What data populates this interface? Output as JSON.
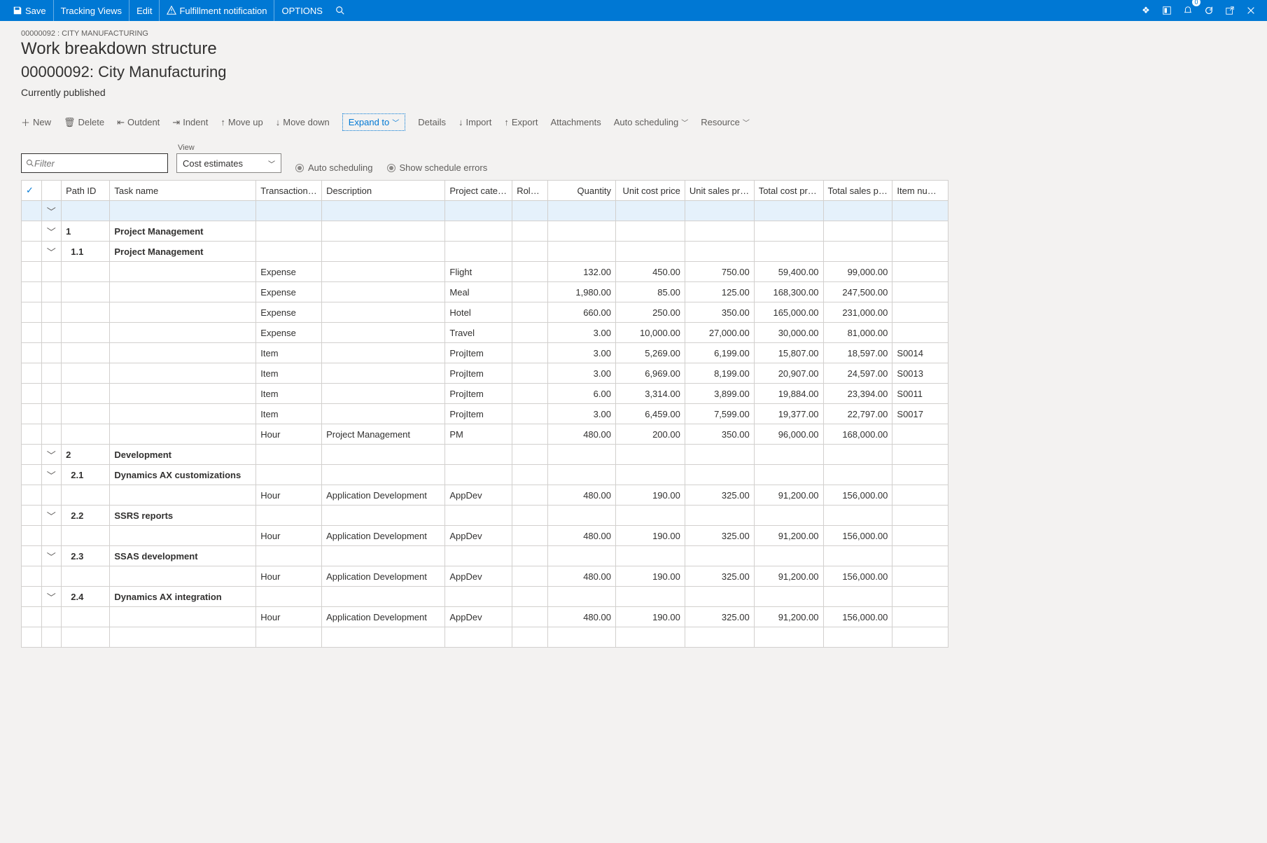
{
  "topmenu": {
    "save": "Save",
    "tracking": "Tracking Views",
    "edit": "Edit",
    "fulfillment": "Fulfillment notification",
    "options": "OPTIONS",
    "badge_count": "0"
  },
  "page": {
    "breadcrumb": "00000092 : CITY MANUFACTURING",
    "title": "Work breakdown structure",
    "subtitle": "00000092: City Manufacturing",
    "status": "Currently published"
  },
  "toolbar": {
    "new": "New",
    "delete": "Delete",
    "outdent": "Outdent",
    "indent": "Indent",
    "moveup": "Move up",
    "movedown": "Move down",
    "expand": "Expand to",
    "details": "Details",
    "import": "Import",
    "export": "Export",
    "attachments": "Attachments",
    "autosched": "Auto scheduling",
    "resource": "Resource"
  },
  "filter": {
    "placeholder": "Filter",
    "view_label": "View",
    "view_value": "Cost estimates",
    "opt_autosched": "Auto scheduling",
    "opt_errors": "Show schedule errors"
  },
  "columns": {
    "pathid": "Path ID",
    "task": "Task name",
    "txtype": "Transaction type",
    "desc": "Description",
    "cat": "Project category",
    "role": "Role ID",
    "qty": "Quantity",
    "ucost": "Unit cost price",
    "usales": "Unit sales price",
    "tcost": "Total cost price",
    "tsales": "Total sales price",
    "item": "Item number"
  },
  "rows": [
    {
      "hl": true,
      "expand": true
    },
    {
      "expand": true,
      "pathid": "1",
      "task": "Project Management",
      "bold": true
    },
    {
      "expand": true,
      "pathid": "1.1",
      "task": "Project Management",
      "bold": true,
      "indent": 1
    },
    {
      "txtype": "Expense",
      "cat": "Flight",
      "qty": "132.00",
      "ucost": "450.00",
      "usales": "750.00",
      "tcost": "59,400.00",
      "tsales": "99,000.00"
    },
    {
      "txtype": "Expense",
      "cat": "Meal",
      "qty": "1,980.00",
      "ucost": "85.00",
      "usales": "125.00",
      "tcost": "168,300.00",
      "tsales": "247,500.00"
    },
    {
      "txtype": "Expense",
      "cat": "Hotel",
      "qty": "660.00",
      "ucost": "250.00",
      "usales": "350.00",
      "tcost": "165,000.00",
      "tsales": "231,000.00"
    },
    {
      "txtype": "Expense",
      "cat": "Travel",
      "qty": "3.00",
      "ucost": "10,000.00",
      "usales": "27,000.00",
      "tcost": "30,000.00",
      "tsales": "81,000.00"
    },
    {
      "txtype": "Item",
      "cat": "ProjItem",
      "qty": "3.00",
      "ucost": "5,269.00",
      "usales": "6,199.00",
      "tcost": "15,807.00",
      "tsales": "18,597.00",
      "item": "S0014"
    },
    {
      "txtype": "Item",
      "cat": "ProjItem",
      "qty": "3.00",
      "ucost": "6,969.00",
      "usales": "8,199.00",
      "tcost": "20,907.00",
      "tsales": "24,597.00",
      "item": "S0013"
    },
    {
      "txtype": "Item",
      "cat": "ProjItem",
      "qty": "6.00",
      "ucost": "3,314.00",
      "usales": "3,899.00",
      "tcost": "19,884.00",
      "tsales": "23,394.00",
      "item": "S0011"
    },
    {
      "txtype": "Item",
      "cat": "ProjItem",
      "qty": "3.00",
      "ucost": "6,459.00",
      "usales": "7,599.00",
      "tcost": "19,377.00",
      "tsales": "22,797.00",
      "item": "S0017"
    },
    {
      "txtype": "Hour",
      "desc": "Project Management",
      "cat": "PM",
      "qty": "480.00",
      "ucost": "200.00",
      "usales": "350.00",
      "tcost": "96,000.00",
      "tsales": "168,000.00"
    },
    {
      "expand": true,
      "pathid": "2",
      "task": "Development",
      "bold": true
    },
    {
      "expand": true,
      "pathid": "2.1",
      "task": "Dynamics AX customizations",
      "bold": true,
      "indent": 1
    },
    {
      "txtype": "Hour",
      "desc": "Application Development",
      "cat": "AppDev",
      "qty": "480.00",
      "ucost": "190.00",
      "usales": "325.00",
      "tcost": "91,200.00",
      "tsales": "156,000.00"
    },
    {
      "expand": true,
      "pathid": "2.2",
      "task": "SSRS reports",
      "bold": true,
      "indent": 1
    },
    {
      "txtype": "Hour",
      "desc": "Application Development",
      "cat": "AppDev",
      "qty": "480.00",
      "ucost": "190.00",
      "usales": "325.00",
      "tcost": "91,200.00",
      "tsales": "156,000.00"
    },
    {
      "expand": true,
      "pathid": "2.3",
      "task": "SSAS development",
      "bold": true,
      "indent": 1
    },
    {
      "txtype": "Hour",
      "desc": "Application Development",
      "cat": "AppDev",
      "qty": "480.00",
      "ucost": "190.00",
      "usales": "325.00",
      "tcost": "91,200.00",
      "tsales": "156,000.00"
    },
    {
      "expand": true,
      "pathid": "2.4",
      "task": "Dynamics AX integration",
      "bold": true,
      "indent": 1
    },
    {
      "txtype": "Hour",
      "desc": "Application Development",
      "cat": "AppDev",
      "qty": "480.00",
      "ucost": "190.00",
      "usales": "325.00",
      "tcost": "91,200.00",
      "tsales": "156,000.00"
    },
    {}
  ]
}
